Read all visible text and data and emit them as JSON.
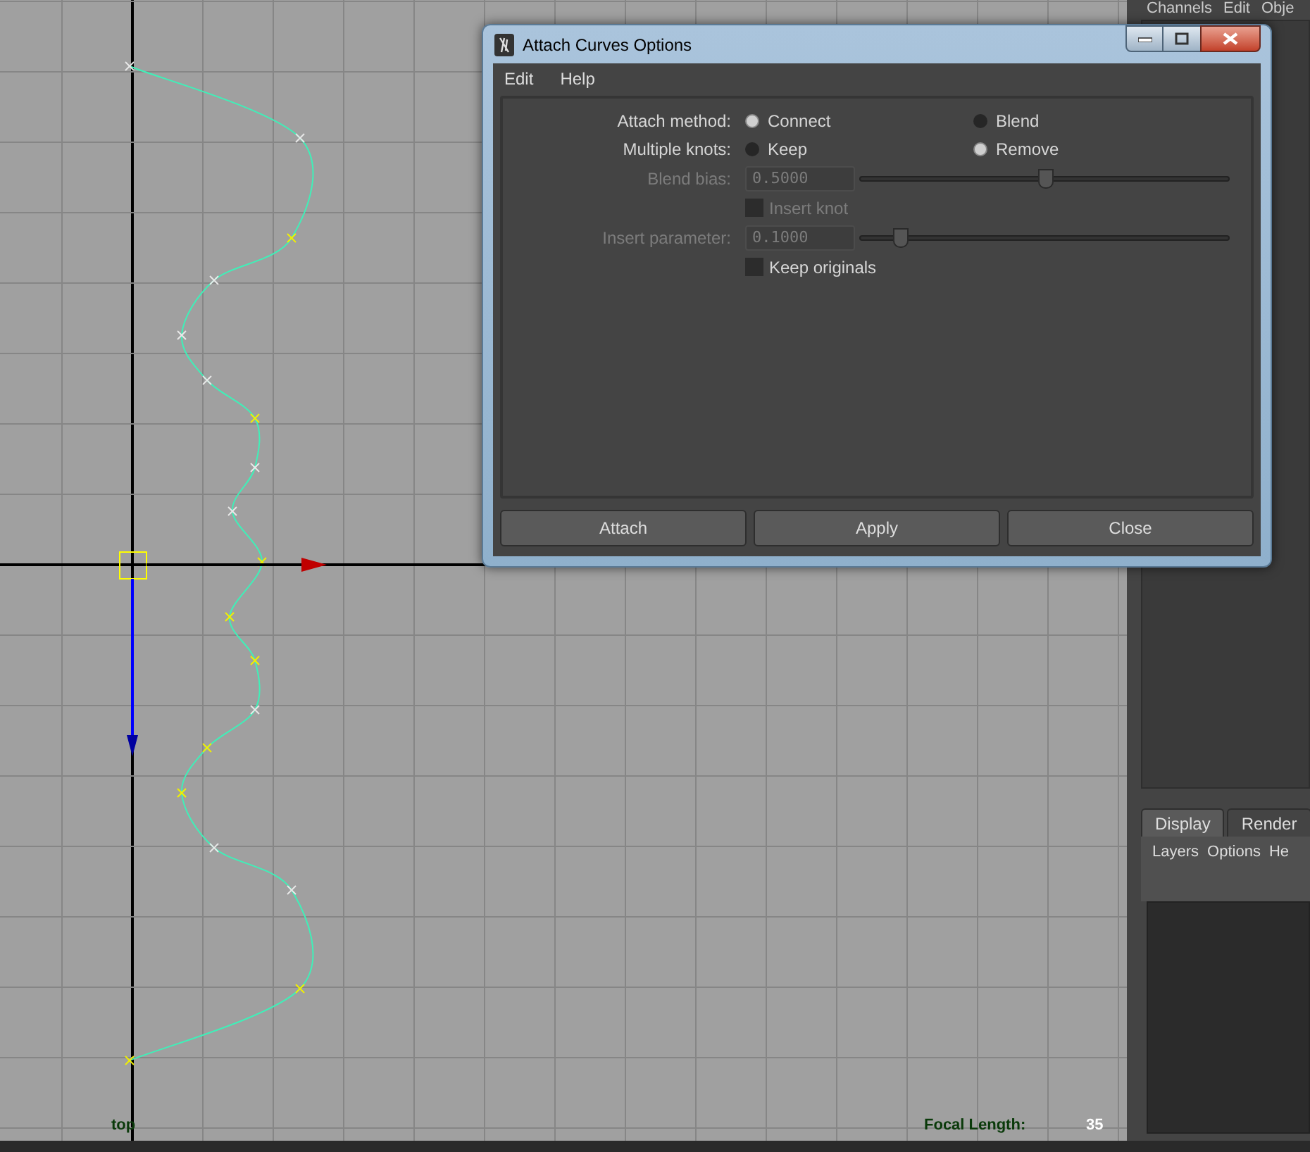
{
  "viewport": {
    "camera": "top",
    "focal_length_label": "Focal Length:",
    "focal_length": "35"
  },
  "channel_box": {
    "menu": [
      "Channels",
      "Edit",
      "Obje"
    ]
  },
  "layer_editor": {
    "tabs": [
      {
        "label": "Display",
        "selected": true
      },
      {
        "label": "Render",
        "selected": false
      }
    ],
    "menu": [
      "Layers",
      "Options",
      "He"
    ]
  },
  "dialog": {
    "title": "Attach Curves Options",
    "menu": [
      "Edit",
      "Help"
    ],
    "options": [
      {
        "kind": "radio",
        "label": "Attach method:",
        "disabled": false,
        "choices": [
          {
            "label": "Connect",
            "selected": true
          },
          {
            "label": "Blend",
            "selected": false
          }
        ]
      },
      {
        "kind": "radio",
        "label": "Multiple knots:",
        "disabled": false,
        "choices": [
          {
            "label": "Keep",
            "selected": false
          },
          {
            "label": "Remove",
            "selected": true
          }
        ]
      },
      {
        "kind": "slider",
        "label": "Blend bias:",
        "value": "0.5000",
        "level": 0.5,
        "disabled": true
      },
      {
        "kind": "checkbox",
        "label": "Insert knot",
        "checked": false,
        "disabled": true
      },
      {
        "kind": "slider",
        "label": "Insert parameter:",
        "value": "0.1000",
        "level": 0.11,
        "disabled": true
      },
      {
        "kind": "checkbox",
        "label": "Keep originals",
        "checked": false,
        "disabled": false
      }
    ],
    "buttons": [
      "Attach",
      "Apply",
      "Close"
    ]
  }
}
